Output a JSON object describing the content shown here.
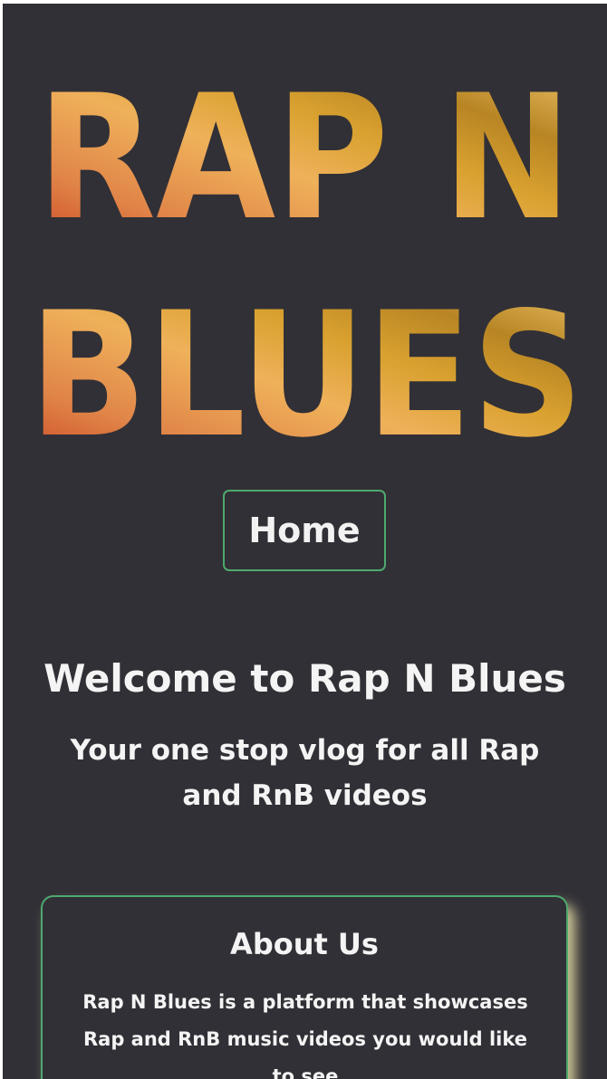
{
  "logo": {
    "line1": "RAP N",
    "line2": "BLUES",
    "gradient_colors": [
      "#c9401f",
      "#e08448",
      "#efb15a",
      "#d9a12f",
      "#b88524",
      "#f0c86c"
    ]
  },
  "nav": {
    "home_label": "Home"
  },
  "hero": {
    "title": "Welcome to Rap N Blues",
    "tagline": "Your one stop vlog for all Rap and RnB videos"
  },
  "about": {
    "title": "About Us",
    "body": "Rap N Blues is a platform that showcases Rap and RnB music videos you would like to see"
  },
  "colors": {
    "background": "#313036",
    "accent_border": "#4ea96e",
    "text": "#f4f4f4",
    "card_glow": "#e8e0a8"
  }
}
